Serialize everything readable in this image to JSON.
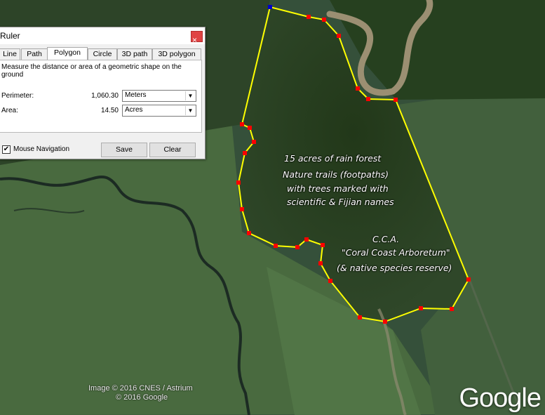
{
  "ruler": {
    "title": "Ruler",
    "close_glyph": "×",
    "tabs": [
      "Line",
      "Path",
      "Polygon",
      "Circle",
      "3D path",
      "3D polygon"
    ],
    "active_tab": "Polygon",
    "description": "Measure the distance or area of a geometric shape on the ground",
    "perimeter": {
      "label": "Perimeter:",
      "value": "1,060.30",
      "unit": "Meters"
    },
    "area": {
      "label": "Area:",
      "value": "14.50",
      "unit": "Acres"
    },
    "mouse_navigation_label": "Mouse Navigation",
    "mouse_navigation_checked": true,
    "check_glyph": "✔",
    "save_label": "Save",
    "clear_label": "Clear",
    "dropdown_glyph": "▼"
  },
  "annotations": {
    "line1": "15 acres of rain forest",
    "line2": "Nature trails (footpaths)",
    "line3": "with trees marked with",
    "line4": "scientific & Fijian names",
    "line5": "C.C.A.",
    "line6": "\"Coral Coast Arboretum\"",
    "line7": "(& native species reserve)"
  },
  "credits": {
    "image": "Image © 2016 CNES / Astrium",
    "copyright": "© 2016 Google",
    "logo": "Google"
  },
  "colors": {
    "polygon_line": "#ffff00",
    "vertex": "#ff0000",
    "start_vertex": "#0000cc",
    "forest": "#2c4126"
  }
}
